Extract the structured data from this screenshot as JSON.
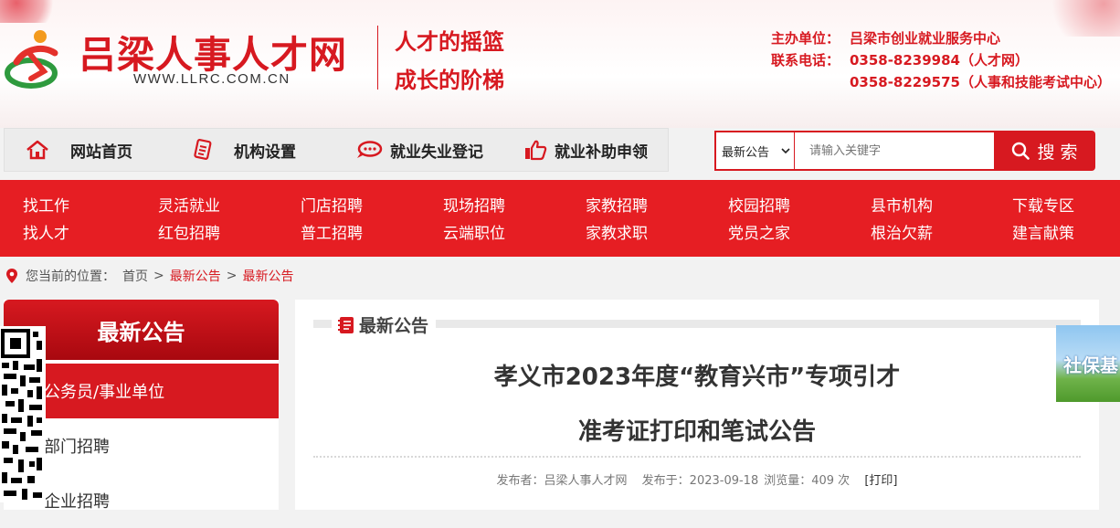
{
  "header": {
    "site_name": "吕梁人事人才网",
    "site_url": "WWW.LLRC.COM.CN",
    "slogan_1": "人才的摇篮",
    "slogan_2": "成长的阶梯",
    "sponsor_label": "主办单位：",
    "sponsor_value": "吕梁市创业就业服务中心",
    "phone_label": "联系电话：",
    "phone_1": "0358-8239984（人才网）",
    "phone_2": "0358-8229575（人事和技能考试中心）"
  },
  "topnav": {
    "items": [
      {
        "label": "网站首页",
        "icon": "home-icon"
      },
      {
        "label": "机构设置",
        "icon": "document-icon"
      },
      {
        "label": "就业失业登记",
        "icon": "chat-bubble-icon"
      },
      {
        "label": "就业补助申领",
        "icon": "thumbs-up-icon"
      }
    ]
  },
  "search": {
    "selected_option": "最新公告",
    "placeholder": "请输入关键字",
    "button_label": "搜 索"
  },
  "categories": {
    "row1": [
      "找工作",
      "灵活就业",
      "门店招聘",
      "现场招聘",
      "家教招聘",
      "校园招聘",
      "县市机构",
      "下载专区"
    ],
    "row2": [
      "找人才",
      "红包招聘",
      "普工招聘",
      "云端职位",
      "家教求职",
      "党员之家",
      "根治欠薪",
      "建言献策"
    ]
  },
  "breadcrumb": {
    "prefix": "您当前的位置：",
    "home": "首页",
    "sep": ">",
    "level1": "最新公告",
    "level2": "最新公告"
  },
  "sidebar": {
    "title": "最新公告",
    "items": [
      "公务员/事业单位",
      "部门招聘",
      "企业招聘"
    ]
  },
  "main": {
    "section_title": "最新公告",
    "article_title_line1": "孝义市2023年度“教育兴市”专项引才",
    "article_title_line2": "准考证打印和笔试公告",
    "publisher": "发布者：吕梁人事人才网",
    "published": "发布于：2023-09-18",
    "views": "浏览量：409 次",
    "print": "[打印]"
  },
  "float_ad": {
    "text": "社保基"
  },
  "colors": {
    "brand_red": "#d71920",
    "category_bar": "#e61e23"
  }
}
